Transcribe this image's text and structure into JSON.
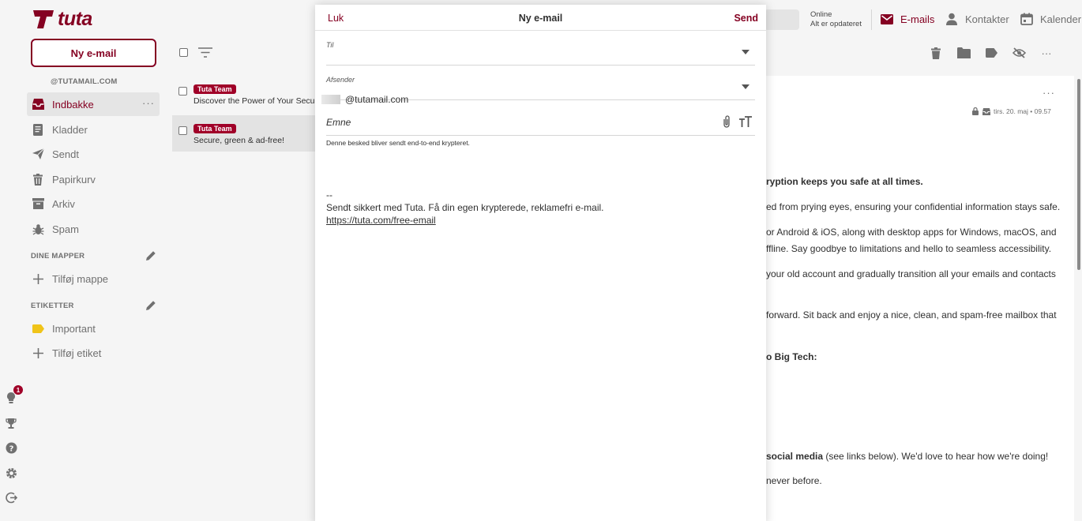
{
  "header": {
    "logo_text": "tuta",
    "status_line1": "Online",
    "status_line2": "Alt er opdateret",
    "nav": [
      {
        "label": "E-mails",
        "icon": "mail-icon"
      },
      {
        "label": "Kontakter",
        "icon": "person-icon"
      },
      {
        "label": "Kalender",
        "icon": "calendar-icon"
      }
    ]
  },
  "sidebar": {
    "new_mail_label": "Ny e-mail",
    "account": "@TUTAMAIL.COM",
    "folders": [
      {
        "label": "Indbakke",
        "icon": "inbox-icon",
        "active": true
      },
      {
        "label": "Kladder",
        "icon": "draft-icon"
      },
      {
        "label": "Sendt",
        "icon": "send-icon"
      },
      {
        "label": "Papirkurv",
        "icon": "trash-icon"
      },
      {
        "label": "Arkiv",
        "icon": "archive-icon"
      },
      {
        "label": "Spam",
        "icon": "bug-icon"
      }
    ],
    "folders_section": "DINE MAPPER",
    "add_folder": "Tilføj mappe",
    "labels_section": "ETIKETTER",
    "labels": [
      {
        "label": "Important",
        "color": "#f0c419"
      }
    ],
    "add_label": "Tilføj etiket",
    "notification_count": "1"
  },
  "mail_list": [
    {
      "sender": "Tuta Team",
      "subject": "Discover the Power of Your Secure",
      "selected": false
    },
    {
      "sender": "Tuta Team",
      "subject": "Secure, green & ad-free!",
      "selected": true
    }
  ],
  "reader": {
    "date": "tirs. 20. maj • 09.57",
    "lines": [
      {
        "bold": "ryption keeps you safe at all times.",
        "text": ""
      },
      {
        "bold": "",
        "text": "ed from prying eyes, ensuring your confidential information stays safe."
      },
      {
        "bold": "",
        "text": "or Android & iOS, along with desktop apps for Windows, macOS, and"
      },
      {
        "bold": "",
        "text": "ffline. Say goodbye to limitations and hello to seamless accessibility."
      },
      {
        "bold": "",
        "text": "your old account and gradually transition all your emails and contacts"
      },
      {
        "bold": "",
        "text": "forward. Sit back and enjoy a nice, clean, and spam-free mailbox that"
      },
      {
        "bold": "o Big Tech:",
        "text": ""
      },
      {
        "bold": "social media",
        "text": " (see links below). We'd love to hear how we're doing!"
      },
      {
        "bold": "",
        "text": "never before."
      }
    ]
  },
  "compose": {
    "close_label": "Luk",
    "title": "Ny e-mail",
    "send_label": "Send",
    "to_label": "Til",
    "from_label": "Afsender",
    "from_value": "@tutamail.com",
    "subject_label": "Emne",
    "notice": "Denne besked bliver sendt end-to-end krypteret.",
    "signature": {
      "dash": "--",
      "line": "Sendt sikkert med Tuta. Få din egen krypterede, reklamefri e-mail.",
      "link": "https://tuta.com/free-email"
    }
  },
  "colors": {
    "accent": "#850122",
    "badge": "#a00028"
  }
}
